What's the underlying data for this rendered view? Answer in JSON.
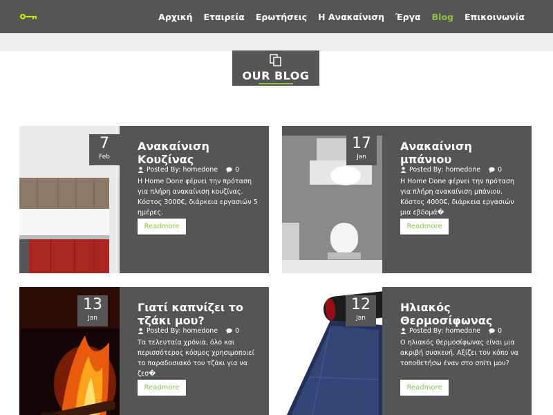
{
  "header": {
    "nav": [
      {
        "label": "Αρχική"
      },
      {
        "label": "Εταιρεία"
      },
      {
        "label": "Ερωτήσεις"
      },
      {
        "label": "Η Ανακαίνιση"
      },
      {
        "label": "Έργα"
      },
      {
        "label": "Blog",
        "active": true
      },
      {
        "label": "Επικοινωνία"
      }
    ],
    "accent_color": "#8ac43f"
  },
  "blog_section": {
    "title": "OUR BLOG",
    "icon": "documents-icon"
  },
  "posts": [
    {
      "day": "7",
      "month": "Feb",
      "title": "Ανακαίνιση Κουζίνας",
      "author_label": "Posted By: homedone",
      "comments": "0",
      "excerpt": "Η Home Done φέρνει την πρόταση για πλήρη ανακαίνιση κουζίνας. Κόστος 3000€, διάρκεια εργασιών 5 ημέρες.",
      "button": "Readmore",
      "image": "kitchen-image"
    },
    {
      "day": "17",
      "month": "Jan",
      "title": "Ανακαίνιση μπάνιου",
      "author_label": "Posted By: homedone",
      "comments": "0",
      "excerpt": "Η Home Done φέρνει την πρόταση για πλήρη ανακαίνιση μπάνιου. Κόστος 4000€, διάρκεια εργασιών μια εβδομά�",
      "button": "Readmore",
      "image": "bathroom-image"
    },
    {
      "day": "13",
      "month": "Jan",
      "title": "Γιατί καπνίζει το τζάκι μου?",
      "author_label": "Posted By: homedone",
      "comments": "0",
      "excerpt": "Τα τελευταία χρόνια, όλο και περισσότερος κόσμος χρησιμοποιεί το παραδοσιακό του τζάκι για να ζεσ�",
      "button": "Readmore",
      "image": "fireplace-image"
    },
    {
      "day": "12",
      "month": "Jan",
      "title": "Ηλιακός Θερμοσίφωνας",
      "author_label": "Posted By: homedone",
      "comments": "0",
      "excerpt": "Ο ηλιακός θερμοσίφωνας είναι μια ακριβή συσκευή. Αξίζει τον κόπο να τοποθετήσω έναν στο σπίτι μου?",
      "button": "Readmore",
      "image": "solar-heater-image"
    }
  ]
}
